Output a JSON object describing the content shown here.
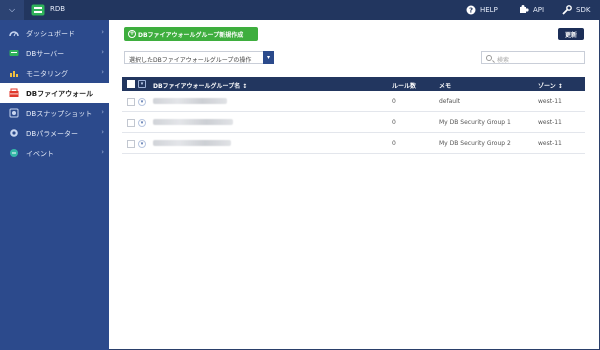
{
  "topbar": {
    "service_title": "RDB",
    "help_label": "HELP",
    "api_label": "API",
    "sdk_label": "SDK"
  },
  "sidebar": {
    "items": [
      {
        "label": "ダッシュボード",
        "icon": "dashboard-gauge-icon",
        "active": false
      },
      {
        "label": "DBサーバー",
        "icon": "db-server-icon",
        "active": false
      },
      {
        "label": "モニタリング",
        "icon": "monitoring-chart-icon",
        "active": false
      },
      {
        "label": "DBファイアウォール",
        "icon": "firewall-icon",
        "active": true
      },
      {
        "label": "DBスナップショット",
        "icon": "snapshot-icon",
        "active": false
      },
      {
        "label": "DBパラメーター",
        "icon": "parameter-gear-icon",
        "active": false
      },
      {
        "label": "イベント",
        "icon": "event-icon",
        "active": false
      }
    ]
  },
  "toolbar": {
    "create_label": "DBファイアウォールグループ新規作成",
    "refresh_label": "更新",
    "action_select_value": "選択したDBファイアウォールグループの操作",
    "search_placeholder": "検索"
  },
  "table": {
    "columns": [
      "DBファイアウォールグループ名",
      "ルール数",
      "メモ",
      "ゾーン"
    ],
    "rows": [
      {
        "name": "",
        "rule_count": "0",
        "memo": "default",
        "zone": "west-11"
      },
      {
        "name": "",
        "rule_count": "0",
        "memo": "My DB Security Group 1",
        "zone": "west-11"
      },
      {
        "name": "",
        "rule_count": "0",
        "memo": "My DB Security Group 2",
        "zone": "west-11"
      }
    ]
  },
  "colors": {
    "topbar": "#22365f",
    "sidebar": "#2c4a8c",
    "create_button": "#3eae3e",
    "table_header": "#22365f"
  }
}
